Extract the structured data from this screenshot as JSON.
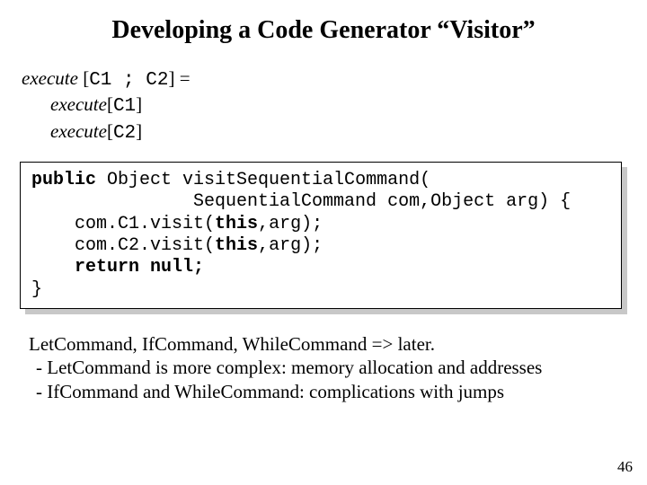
{
  "title": "Developing a Code Generator “Visitor”",
  "exec": {
    "kw": "execute",
    "lhs_open": "[",
    "c1": "C1",
    "sep": " ; ",
    "c2": "C2",
    "lhs_close": "]",
    "eq": " =",
    "line2_open": "[",
    "line2_c": "C1",
    "line2_close": "]",
    "line3_open": "[",
    "line3_c": "C2",
    "line3_close": "]"
  },
  "code": {
    "l1a": "public",
    "l1b": " Object visitSequentialCommand(",
    "l2": "               SequentialCommand com,Object arg) {",
    "l3a": "    com.C1.visit(",
    "l3b": "this",
    "l3c": ",arg);",
    "l4a": "    com.C2.visit(",
    "l4b": "this",
    "l4c": ",arg);",
    "l5a": "    ",
    "l5b": "return null;",
    "l6": "}"
  },
  "notes": {
    "l1": "LetCommand, IfCommand, WhileCommand => later.",
    "l2": " - LetCommand is more complex: memory allocation and addresses",
    "l3": " - IfCommand and WhileCommand: complications with jumps"
  },
  "page": "46"
}
